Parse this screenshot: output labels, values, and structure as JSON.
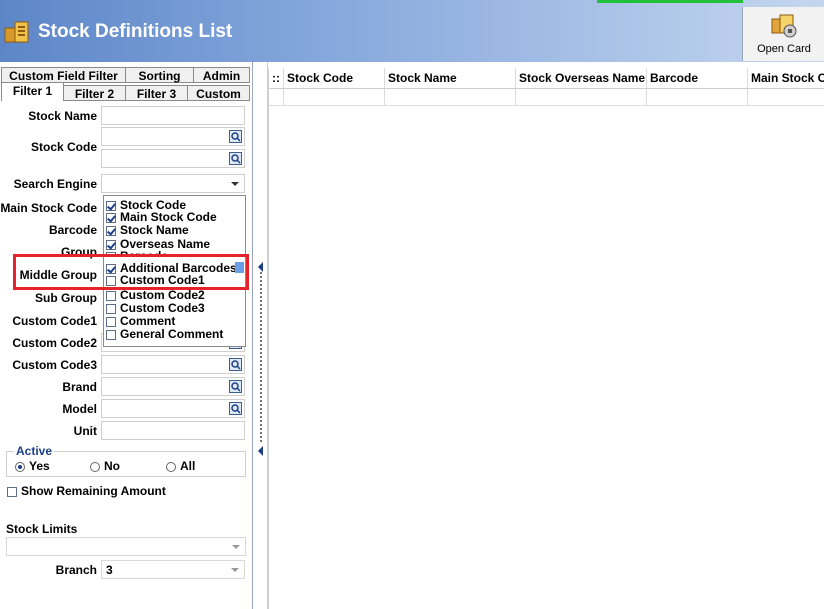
{
  "window": {
    "title": "Stock Definitions List",
    "open_card_label": "Open Card"
  },
  "tabs_row1": [
    "Custom Field Filter",
    "Sorting",
    "Admin"
  ],
  "tabs_row2": [
    "Filter 1",
    "Filter 2",
    "Filter 3",
    "Custom"
  ],
  "active_tab": "Filter 1",
  "filter": {
    "stock_name": "Stock Name",
    "stock_code": "Stock Code",
    "search_engine": "Search Engine",
    "main_stock_code": "Main Stock Code",
    "barcode": "Barcode",
    "group": "Group",
    "middle_group": "Middle Group",
    "sub_group": "Sub Group",
    "custom_code1": "Custom Code1",
    "custom_code2": "Custom Code2",
    "custom_code3": "Custom Code3",
    "brand": "Brand",
    "model": "Model",
    "unit": "Unit"
  },
  "search_engine_options": [
    {
      "label": "Stock Code",
      "checked": true
    },
    {
      "label": "Main Stock Code",
      "checked": true
    },
    {
      "label": "Stock Name",
      "checked": true
    },
    {
      "label": "Overseas Name",
      "checked": true
    },
    {
      "label": "Barcode",
      "checked": true
    },
    {
      "label": "Additional Barcodes",
      "checked": true
    },
    {
      "label": "Custom Code1",
      "checked": false
    },
    {
      "label": "Custom Code2",
      "checked": false
    },
    {
      "label": "Custom Code3",
      "checked": false
    },
    {
      "label": "Comment",
      "checked": false
    },
    {
      "label": "General Comment",
      "checked": false
    }
  ],
  "active": {
    "title": "Active",
    "yes": "Yes",
    "no": "No",
    "all": "All",
    "selected": "Yes"
  },
  "show_remaining_amount": "Show Remaining Amount",
  "stock_limits": "Stock Limits",
  "branch": {
    "label": "Branch",
    "value": "3"
  },
  "grid_columns": [
    "Stock Code",
    "Stock Name",
    "Stock Overseas Name",
    "Barcode",
    "Main Stock Code"
  ],
  "colors": {
    "title_bar": "#5d86c8",
    "highlight": "#e5232b",
    "accent": "#1d3f8a"
  }
}
